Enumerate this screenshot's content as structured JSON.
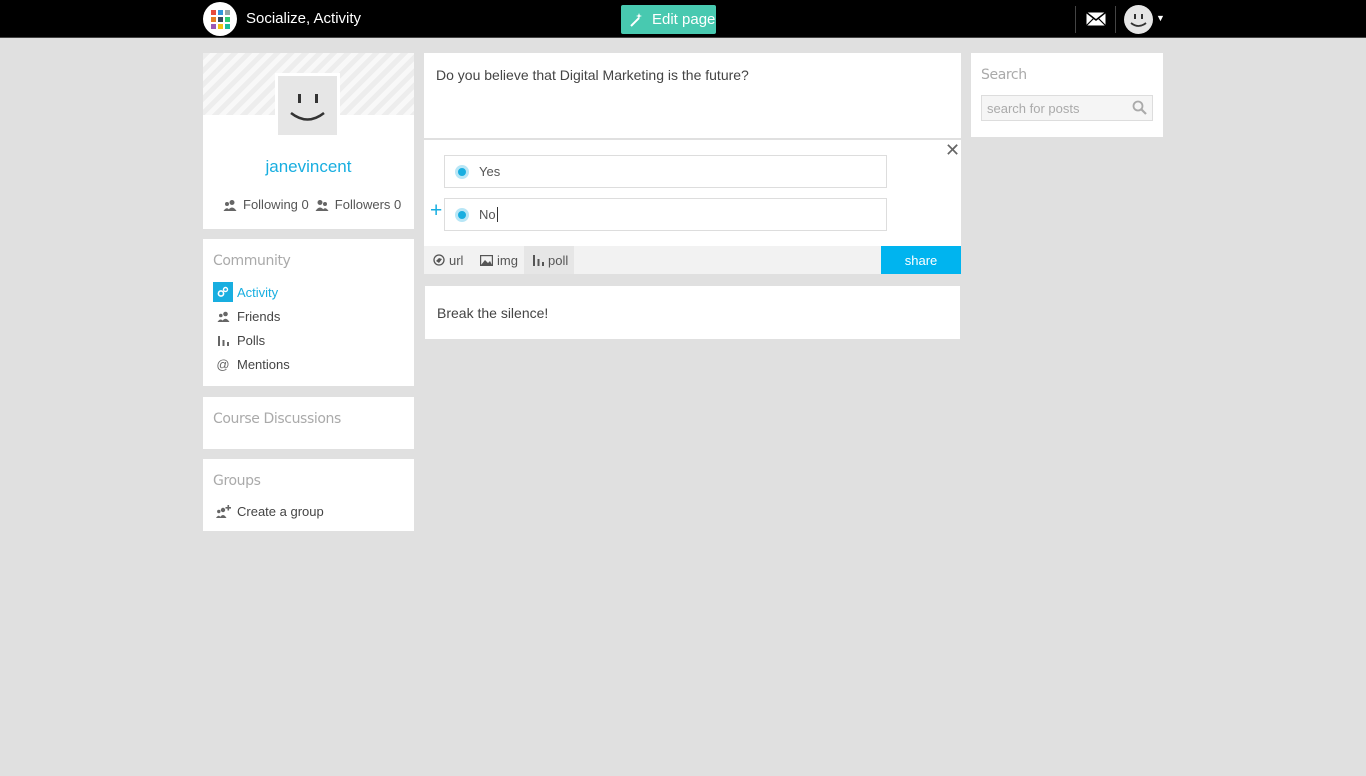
{
  "header": {
    "app_title": "Socialize, Activity",
    "edit_button_label": "Edit page",
    "logo_colors": [
      "#e74c3c",
      "#3498db",
      "#95a5a6",
      "#e67e22",
      "#34495e",
      "#2ecc71",
      "#9b59b6",
      "#f1c40f",
      "#1abc9c"
    ]
  },
  "profile": {
    "username": "janevincent",
    "following_label": "Following",
    "following_count": "0",
    "followers_label": "Followers",
    "followers_count": "0"
  },
  "community": {
    "title": "Community",
    "items": [
      {
        "label": "Activity",
        "icon": "activity-icon",
        "active": true
      },
      {
        "label": "Friends",
        "icon": "friends-icon",
        "active": false
      },
      {
        "label": "Polls",
        "icon": "poll-icon",
        "active": false
      },
      {
        "label": "Mentions",
        "icon": "mention-icon",
        "active": false
      }
    ]
  },
  "course": {
    "title": "Course Discussions"
  },
  "groups": {
    "title": "Groups",
    "create_label": "Create a group"
  },
  "composer": {
    "question": "Do you believe that Digital Marketing is the future?",
    "options": [
      "Yes",
      "No"
    ],
    "tools": [
      "url",
      "img",
      "poll"
    ],
    "share_label": "share"
  },
  "feed": {
    "empty_text": "Break the silence!"
  },
  "search": {
    "title": "Search",
    "placeholder": "search for posts"
  },
  "colors": {
    "accent": "#18aee0",
    "share": "#00b4ef",
    "edit": "#48c9b0"
  }
}
